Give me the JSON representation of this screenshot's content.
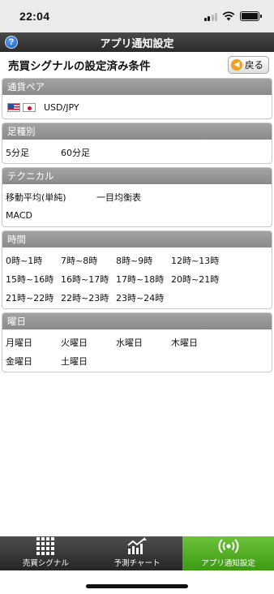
{
  "status_bar": {
    "time": "22:04"
  },
  "nav": {
    "title": "アプリ通知設定",
    "help_label": "?"
  },
  "header": {
    "title": "売買シグナルの設定済み条件",
    "back_label": "戻る"
  },
  "currency": {
    "heading": "通貨ペア",
    "pair": "USD/JPY",
    "flags": [
      "us-flag",
      "jp-flag"
    ]
  },
  "timeframe": {
    "heading": "足種別",
    "items": [
      "5分足",
      "60分足"
    ]
  },
  "technical": {
    "heading": "テクニカル",
    "items": [
      "移動平均(単純)",
      "一目均衡表",
      "MACD"
    ]
  },
  "hours": {
    "heading": "時間",
    "rows": [
      [
        "0時~1時",
        "7時~8時",
        "8時~9時",
        "12時~13時"
      ],
      [
        "15時~16時",
        "16時~17時",
        "17時~18時",
        "20時~21時"
      ],
      [
        "21時~22時",
        "22時~23時",
        "23時~24時"
      ]
    ]
  },
  "weekdays": {
    "heading": "曜日",
    "rows": [
      [
        "月曜日",
        "火曜日",
        "水曜日",
        "木曜日"
      ],
      [
        "金曜日",
        "土曜日"
      ]
    ]
  },
  "tabs": [
    {
      "label": "売買シグナル",
      "icon": "grid-icon",
      "active": false
    },
    {
      "label": "予測チャート",
      "icon": "chart-icon",
      "active": false
    },
    {
      "label": "アプリ通知設定",
      "icon": "broadcast-icon",
      "active": true
    }
  ],
  "colors": {
    "accent_green": "#4caf1a",
    "header_gray": "#8a8a8a",
    "nav_dark": "#2b2b2b",
    "back_orange": "#f0a020"
  }
}
